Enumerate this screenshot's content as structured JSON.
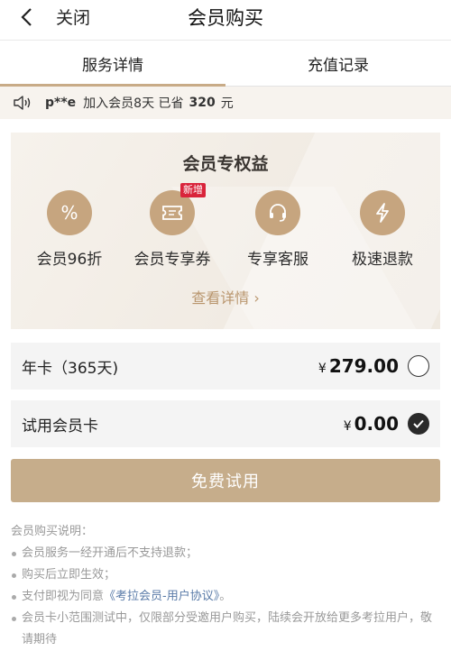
{
  "nav": {
    "close_label": "关闭",
    "title": "会员购买"
  },
  "tabs": [
    {
      "label": "服务详情",
      "active": true
    },
    {
      "label": "充值记录",
      "active": false
    }
  ],
  "notice": {
    "user": "p**e",
    "text": "加入会员8天  已省",
    "amount": "320",
    "unit": "元"
  },
  "benefits": {
    "title": "会员专权益",
    "items": [
      {
        "label": "会员96折",
        "icon": "percent-icon",
        "glyph": "%"
      },
      {
        "label": "会员专享券",
        "icon": "coupon-icon",
        "badge": "新增"
      },
      {
        "label": "专享客服",
        "icon": "headset-icon"
      },
      {
        "label": "极速退款",
        "icon": "lightning-icon"
      }
    ],
    "more_label": "查看详情 ›"
  },
  "plans": [
    {
      "name": "年卡（365天)",
      "currency": "¥",
      "price": "279.00",
      "selected": false
    },
    {
      "name": "试用会员卡",
      "currency": "¥",
      "price": "0.00",
      "selected": true
    }
  ],
  "cta_label": "免费试用",
  "notes": {
    "heading": "会员购买说明：",
    "items": [
      "会员服务一经开通后不支持退款；",
      "购买后立即生效；"
    ],
    "agree_prefix": "支付即视为同意",
    "agree_link": "《考拉会员-用户协议》",
    "agree_suffix": "。",
    "last_item": "会员卡小范围测试中，仅限部分受邀用户购买，陆续会开放给更多考拉用户，敬请期待"
  },
  "colors": {
    "gold": "#c6a57f",
    "cta": "#c6ad8b",
    "badge": "#d9243b",
    "link": "#5a7ba8"
  }
}
